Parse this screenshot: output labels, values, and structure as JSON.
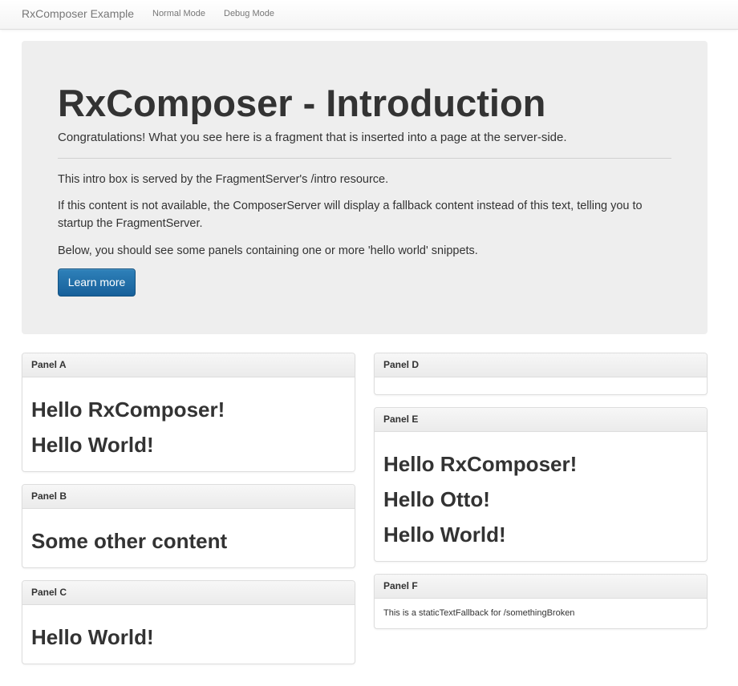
{
  "navbar": {
    "brand": "RxComposer Example",
    "links": [
      "Normal Mode",
      "Debug Mode"
    ]
  },
  "intro": {
    "title": "RxComposer - Introduction",
    "lead": "Congratulations! What you see here is a fragment that is inserted into a page at the server-side.",
    "paragraphs": [
      "This intro box is served by the FragmentServer's /intro resource.",
      "If this content is not available, the ComposerServer will display a fallback content instead of this text, telling you to startup the FragmentServer.",
      "Below, you should see some panels containing one or more 'hello world' snippets."
    ],
    "button_label": "Learn more"
  },
  "panels": {
    "a": {
      "title": "Panel A",
      "items": [
        "Hello RxComposer!",
        "Hello World!"
      ]
    },
    "b": {
      "title": "Panel B",
      "items": [
        "Some other content"
      ]
    },
    "c": {
      "title": "Panel C",
      "items": [
        "Hello World!"
      ]
    },
    "d": {
      "title": "Panel D",
      "items": []
    },
    "e": {
      "title": "Panel E",
      "items": [
        "Hello RxComposer!",
        "Hello Otto!",
        "Hello World!"
      ]
    },
    "f": {
      "title": "Panel F",
      "text": "This is a staticTextFallback for /somethingBroken"
    }
  },
  "colors": {
    "button": "#1e6ea7",
    "jumbotron_bg": "#eeeeee",
    "panel_border": "#dddddd"
  }
}
